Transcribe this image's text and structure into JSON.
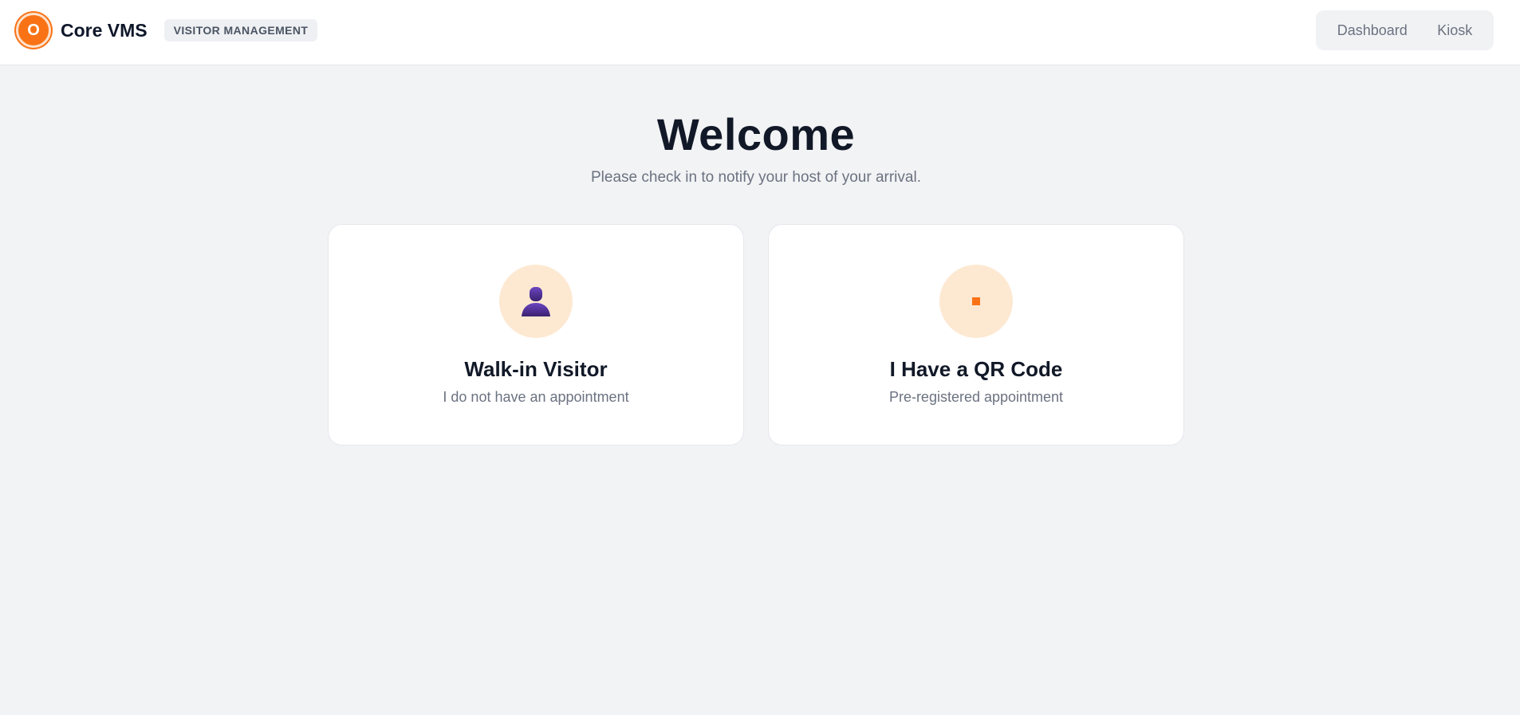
{
  "header": {
    "logo_letter": "O",
    "app_name": "Core VMS",
    "badge": "VISITOR MANAGEMENT",
    "nav": [
      {
        "label": "Dashboard"
      },
      {
        "label": "Kiosk"
      }
    ]
  },
  "hero": {
    "title": "Welcome",
    "subtitle": "Please check in to notify your host of your arrival."
  },
  "options": [
    {
      "title": "Walk-in Visitor",
      "subtitle": "I do not have an appointment",
      "icon": "person-icon"
    },
    {
      "title": "I Have a QR Code",
      "subtitle": "Pre-registered appointment",
      "icon": "qr-code-icon"
    }
  ],
  "colors": {
    "accent": "#f97316",
    "icon_bg": "#fde9d2",
    "person": "#4c2a85",
    "background": "#f2f3f5"
  }
}
